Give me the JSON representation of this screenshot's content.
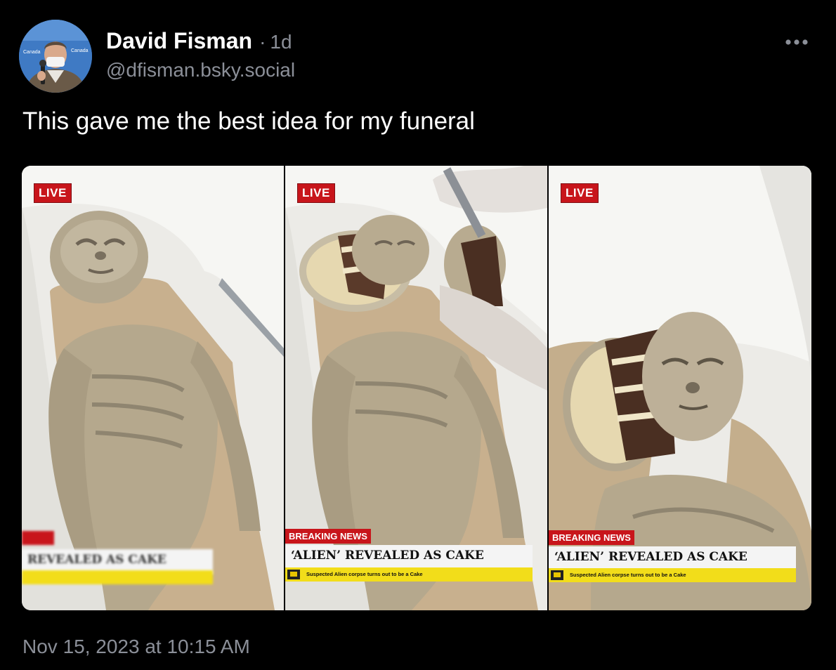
{
  "post": {
    "author_name": "David Fisman",
    "separator": "·",
    "time_ago": "1d",
    "handle": "@dfisman.bsky.social",
    "text": "This gave me the best idea for my funeral",
    "timestamp": "Nov 15, 2023 at 10:15 AM"
  },
  "avatar": {
    "backdrop_text": "Canada"
  },
  "menu": {
    "icon": "more-horizontal-icon"
  },
  "media": {
    "panels": [
      {
        "live": "LIVE",
        "breaking": "",
        "headline": "REVEALED AS CAKE",
        "ticker": ""
      },
      {
        "live": "LIVE",
        "breaking": "BREAKING NEWS",
        "headline": "‘ALIEN’ REVEALED AS CAKE",
        "ticker": "Suspected Alien corpse turns out to be a Cake"
      },
      {
        "live": "LIVE",
        "breaking": "BREAKING NEWS",
        "headline": "‘ALIEN’ REVEALED AS CAKE",
        "ticker": "Suspected Alien corpse turns out to be a Cake"
      }
    ]
  },
  "colors": {
    "background": "#000000",
    "muted_text": "#8b8f98",
    "live_red": "#c8151b",
    "ticker_yellow": "#f2dd1a"
  }
}
